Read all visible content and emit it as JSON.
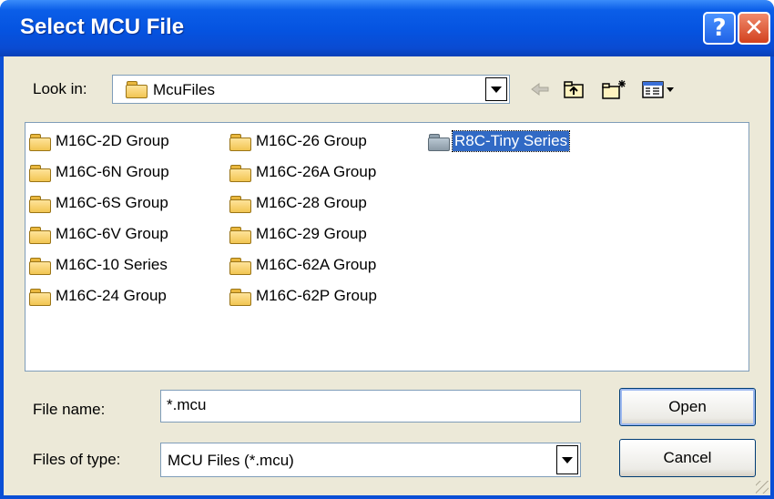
{
  "dialog": {
    "title": "Select MCU File",
    "help_glyph": "?",
    "close_glyph": "✕"
  },
  "look_in": {
    "label": "Look in:",
    "value": "McuFiles"
  },
  "toolbar": {
    "icons": [
      "back-arrow-icon",
      "up-folder-icon",
      "new-folder-icon",
      "view-menu-icon"
    ]
  },
  "files": {
    "column1": [
      "M16C-2D Group",
      "M16C-6N Group",
      "M16C-6S Group",
      "M16C-6V Group",
      "M16C-10 Series",
      "M16C-24 Group"
    ],
    "column2": [
      "M16C-26 Group",
      "M16C-26A Group",
      "M16C-28 Group",
      "M16C-29 Group",
      "M16C-62A Group",
      "M16C-62P Group"
    ],
    "column3": [
      "R8C-Tiny Series"
    ],
    "selected": "R8C-Tiny Series"
  },
  "file_name": {
    "label": "File name:",
    "value": "*.mcu"
  },
  "file_type": {
    "label": "Files of type:",
    "value": "MCU Files (*.mcu)"
  },
  "buttons": {
    "open": "Open",
    "cancel": "Cancel"
  },
  "colors": {
    "title_bar": "#0553e0",
    "dialog_bg": "#ece9d8",
    "selection": "#316ac5"
  }
}
